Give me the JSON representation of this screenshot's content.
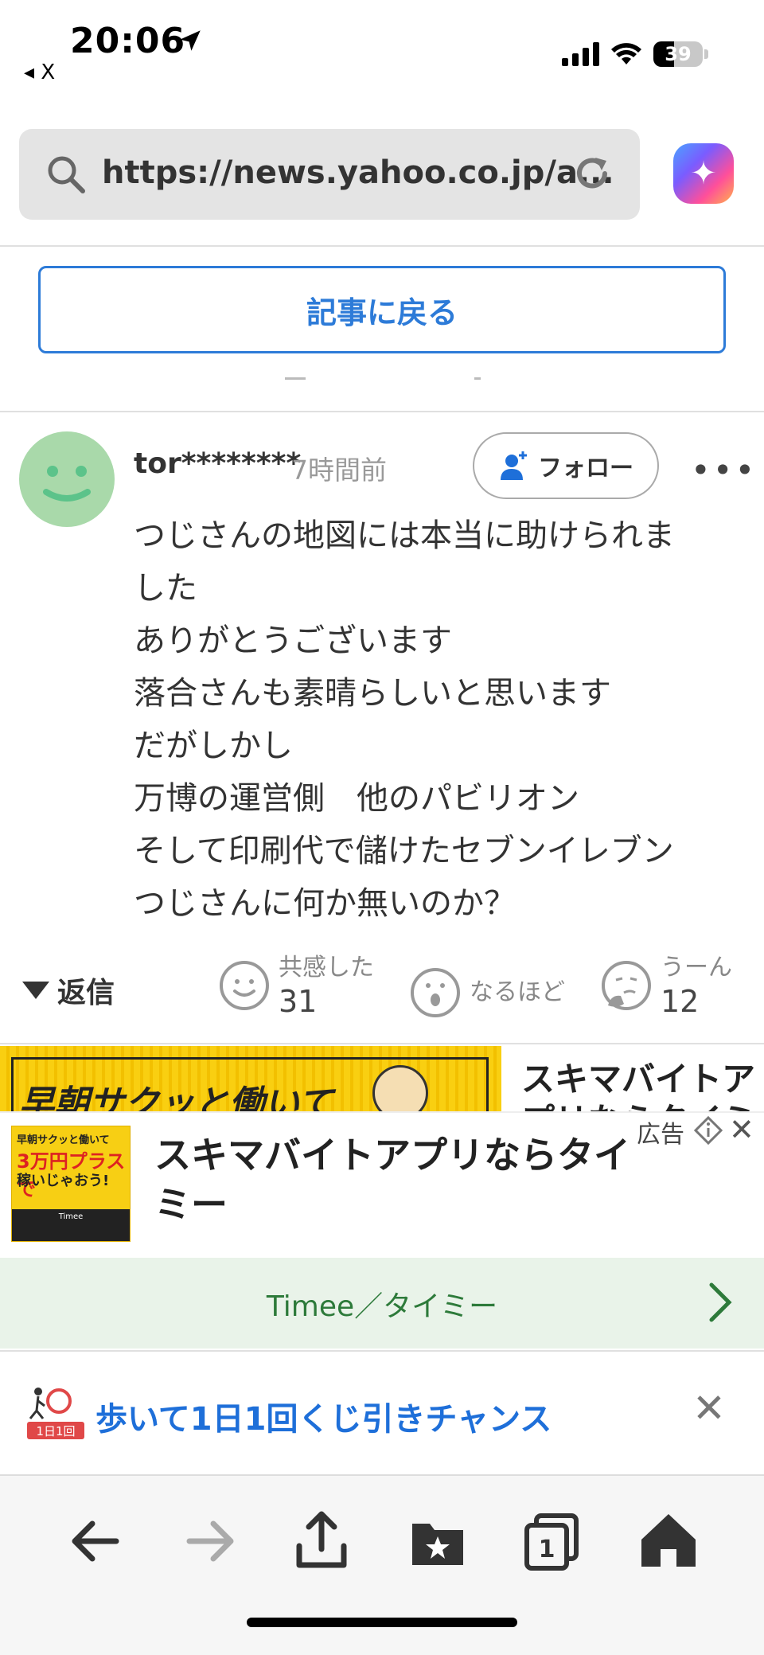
{
  "status_bar": {
    "time": "20:06",
    "back_label": "◂ X",
    "battery": "39"
  },
  "browser": {
    "url": "https://news.yahoo.co.jp/a..."
  },
  "article": {
    "back_button": "記事に戻る"
  },
  "comment": {
    "username": "tor********",
    "time_ago": "7時間前",
    "follow_label": "フォロー",
    "more_label": "•••",
    "lines": [
      "つじさんの地図には本当に助けられま",
      "した",
      "ありがとうございます",
      "落合さんも素晴らしいと思います",
      "だがしかし",
      "万博の運営側　他のパビリオン",
      "そして印刷代で儲けたセブンイレブン",
      "つじさんに何か無いのか？"
    ],
    "reply_label": "返信",
    "reactions": [
      {
        "label": "共感した",
        "count": "31",
        "icon": "smile-face-icon"
      },
      {
        "label": "なるほど",
        "count": "",
        "icon": "surprised-face-icon"
      },
      {
        "label": "うーん",
        "count": "12",
        "icon": "thinking-face-icon"
      }
    ]
  },
  "ad": {
    "banner_text": "早朝サクッと働いて",
    "top_title": "スキマバイトアプリならタイミ",
    "label": "広告",
    "title": "スキマバイトアプリならタイミー",
    "thumb_line1": "早朝サクッと働いて",
    "thumb_line2": "3万円プラスで",
    "thumb_line3": "稼いじゃおう!",
    "thumb_footer": "Timee",
    "advertiser": "Timee／タイミー"
  },
  "lottery": {
    "text": "歩いて1日1回くじ引きチャンス",
    "badge": "1日1回"
  },
  "colors": {
    "accent": "#2d7bd8",
    "ad_green": "#2d7a3a",
    "ad_yellow": "#f9cf11"
  }
}
